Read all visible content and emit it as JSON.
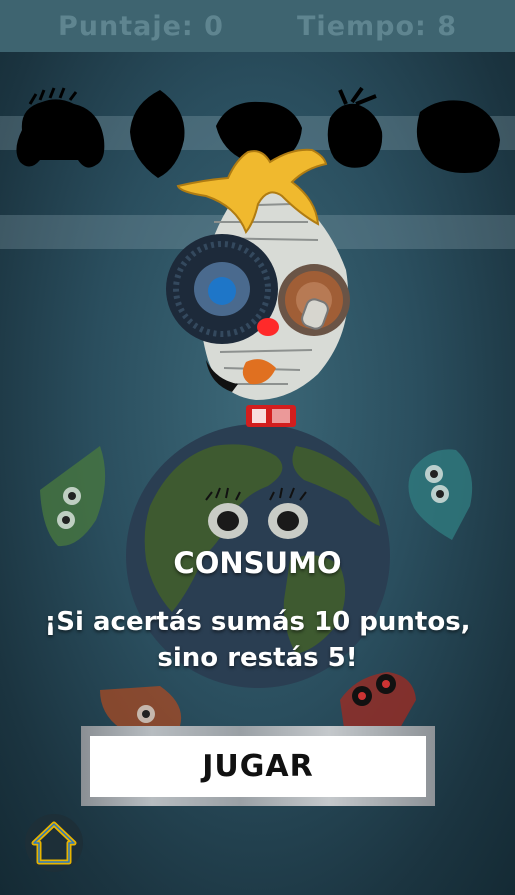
{
  "hud": {
    "score": "Puntaje: 0",
    "time": "Tiempo: 8"
  },
  "overlay": {
    "title": "CONSUMO",
    "message_line1": "¡Si acertás sumás 10 puntos,",
    "message_line2": "sino restás 5!"
  },
  "play_button": {
    "label": "JUGAR"
  },
  "icons": {
    "home": "home-icon",
    "mascot": "recycled-face-mascot",
    "earth": "earth-globe-icon"
  },
  "colors": {
    "background": "#2a4e5e",
    "hud_bar": "#3e6470",
    "hud_text": "#5f8590",
    "overlay_text": "#ffffff",
    "home_icon": "#e8b400"
  }
}
